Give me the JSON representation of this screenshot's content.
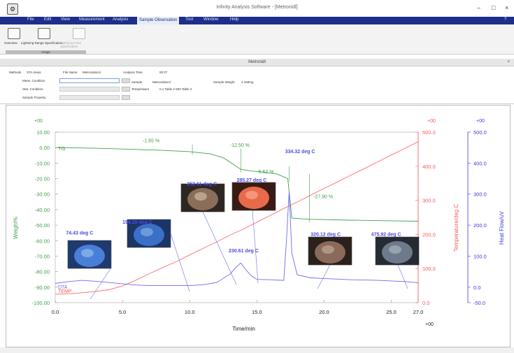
{
  "window": {
    "title": "Infinity Analysis Software - [Metronidl]",
    "minimize": "–",
    "maximize": "□",
    "close": "×"
  },
  "menu": {
    "items": [
      "File",
      "Edit",
      "View",
      "Measurement",
      "Analysis",
      "Sample Observation",
      "Tool",
      "Window",
      "Help"
    ],
    "active": "Sample Observation",
    "help_button": "?"
  },
  "ribbon": {
    "buttons": [
      "Overview",
      "Lightning Range Specification",
      "Lightning Point Specification"
    ],
    "group_label": "Image"
  },
  "document": {
    "title": "Metronidl",
    "close": "×"
  },
  "info": {
    "method_label": "Methods",
    "method_value": "STA.meas",
    "filename_label": "File Name",
    "filename_value": "Metronidazol",
    "analysis_time_label": "Analysis Time",
    "analysis_time_value": "00:27",
    "meas_condition_label": "Meas. Condition",
    "stat_condition_label": "Stat. Condition",
    "sample_property_label": "Sample Property",
    "sample_label": "Sample",
    "sample_value": "Metronidazol",
    "temperature_label": "Temperature",
    "temperature_value": "0.1 Table 2   500 Table 2",
    "sample_weight_label": "Sample Weight",
    "sample_weight_value": "4.169mg"
  },
  "chart_data": {
    "type": "line",
    "xlabel": "Time/min",
    "x_ticks": [
      "0.0",
      "5.0",
      "10.0",
      "15.0",
      "20.0",
      "25.0",
      "27.0"
    ],
    "xlim": [
      0,
      27
    ],
    "left_axis": {
      "label": "Weight%",
      "top_label": "+00",
      "ticks": [
        "10.00",
        "0.00",
        "-10.00",
        "-20.00",
        "-30.00",
        "-40.00",
        "-50.00",
        "-60.00",
        "-70.00",
        "-80.00",
        "-90.00",
        "-100.00"
      ],
      "ylim": [
        -100,
        10
      ]
    },
    "temp_axis": {
      "label": "Temperature/deg C",
      "top_label": "+00",
      "ticks": [
        "500.0",
        "400.0",
        "300.0",
        "200.0",
        "100.0",
        "0.0"
      ],
      "ylim": [
        0,
        500
      ]
    },
    "dta_axis": {
      "label": "Heat Flow/uV",
      "top_label": "+00",
      "ticks": [
        "500.0",
        "400.0",
        "300.0",
        "200.0",
        "100.0",
        "0.0",
        "-50.0"
      ],
      "ylim": [
        -50,
        500
      ]
    },
    "x_corner_label": "+00",
    "series": [
      {
        "name": "TG",
        "color": "#3fa047",
        "x": [
          0.0,
          1.5,
          3.0,
          5.0,
          7.5,
          10.0,
          11.5,
          12.5,
          13.2,
          13.8,
          14.6,
          15.5,
          16.5,
          17.3,
          17.6,
          18.5,
          19.0,
          22.0,
          25.0,
          27.0
        ],
        "y": [
          0.0,
          -0.1,
          -0.4,
          -0.9,
          -1.6,
          -2.6,
          -4.0,
          -6.5,
          -10.5,
          -14.0,
          -15.1,
          -15.8,
          -17.0,
          -20.0,
          -45.5,
          -46.0,
          -46.2,
          -46.8,
          -47.2,
          -47.5
        ]
      },
      {
        "name": "TEMP",
        "color": "#ff6b6b",
        "x": [
          0,
          1,
          2,
          3,
          4,
          5,
          6,
          7,
          8,
          9,
          10,
          11,
          12,
          13,
          14,
          15,
          16,
          17,
          18,
          19,
          20,
          21,
          22,
          23,
          24,
          25,
          26,
          27
        ],
        "y": [
          25,
          26,
          29,
          33,
          38,
          49,
          66,
          85,
          103,
          120,
          140,
          159,
          178,
          198,
          216,
          236,
          256,
          276,
          295,
          315,
          335,
          354,
          374,
          393,
          413,
          433,
          452,
          472
        ]
      },
      {
        "name": "DTA",
        "color": "#6b6bf2",
        "x": [
          0,
          1,
          2,
          3,
          4,
          5,
          6,
          7,
          8,
          9,
          10,
          11,
          12,
          13,
          13.4,
          13.8,
          14.2,
          14.6,
          15,
          16,
          17,
          17.2,
          17.4,
          17.6,
          18,
          19,
          20,
          21,
          22,
          23,
          24,
          25,
          26,
          27
        ],
        "y": [
          12,
          18,
          22,
          19,
          15,
          11,
          7,
          5,
          5,
          5,
          5,
          8,
          15,
          42,
          62,
          78,
          55,
          36,
          25,
          24,
          22,
          150,
          310,
          110,
          40,
          30,
          28,
          26,
          24,
          23,
          22,
          20,
          18,
          14
        ]
      }
    ],
    "annotations": [
      {
        "text": "-1.65 %",
        "x": 6.5,
        "y": 3.5,
        "color": "#3fa047"
      },
      {
        "text": "-12.50 %",
        "x": 13.0,
        "y": 0.5,
        "color": "#3fa047"
      },
      {
        "text": "-5.62 %",
        "x": 15.0,
        "y": -16.5,
        "color": "#3fa047"
      },
      {
        "text": "-27.90 %",
        "x": 19.2,
        "y": -32.5,
        "color": "#3fa047"
      },
      {
        "text": "334.32 deg C",
        "x": 17.1,
        "y": -3.5,
        "color": "#4a4ae6"
      },
      {
        "text": "285.27 deg C",
        "x": 13.5,
        "y": -22.0,
        "color": "#4a4ae6"
      },
      {
        "text": "252.61 deg C",
        "x": 9.8,
        "y": -24.5,
        "color": "#4a4ae6"
      },
      {
        "text": "194.29 deg C",
        "x": 5.0,
        "y": -49.0,
        "color": "#4a4ae6"
      },
      {
        "text": "74.43 deg C",
        "x": 0.8,
        "y": -56.0,
        "color": "#4a4ae6"
      },
      {
        "text": "230.61 deg C",
        "x": 12.9,
        "y": -67.5,
        "color": "#4a4ae6"
      },
      {
        "text": "320.12 deg C",
        "x": 19.0,
        "y": -57.0,
        "color": "#4a4ae6"
      },
      {
        "text": "475.92 deg C",
        "x": 23.5,
        "y": -57.0,
        "color": "#4a4ae6"
      }
    ],
    "grid": false,
    "legend": "inline"
  },
  "thumbnails": [
    {
      "label": "74.43 deg C",
      "colors": [
        "#4a7fd8",
        "#1e3a6e",
        "#9ec4f2"
      ]
    },
    {
      "label": "194.29 deg C",
      "colors": [
        "#3b70c8",
        "#1b3566",
        "#8fb6e8"
      ]
    },
    {
      "label": "252.61 deg C",
      "colors": [
        "#8a6e5a",
        "#2e2622",
        "#d9c7b4"
      ]
    },
    {
      "label": "285.27 deg C",
      "colors": [
        "#e86a4a",
        "#3a1a14",
        "#ffb39a"
      ]
    },
    {
      "label": "320.12 deg C",
      "colors": [
        "#8a6a58",
        "#2a201c",
        "#c9b2a0"
      ]
    },
    {
      "label": "475.92 deg C",
      "colors": [
        "#6d7a8c",
        "#262a32",
        "#b3bcc8"
      ]
    }
  ]
}
